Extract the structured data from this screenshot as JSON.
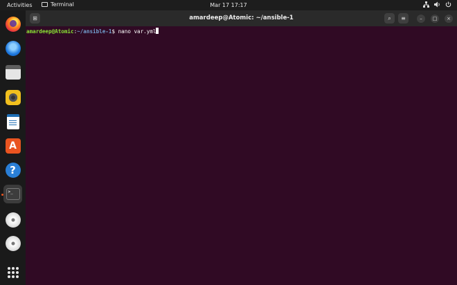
{
  "topbar": {
    "activities_label": "Activities",
    "app_label": "Terminal",
    "clock": "Mar 17  17:17",
    "tray_icons": [
      "network-icon",
      "volume-icon",
      "power-icon"
    ]
  },
  "dock": {
    "items": [
      {
        "name": "firefox",
        "icon": "firefox-icon"
      },
      {
        "name": "thunderbird",
        "icon": "thunderbird-icon"
      },
      {
        "name": "files",
        "icon": "files-icon"
      },
      {
        "name": "rhythmbox",
        "icon": "rhythmbox-icon"
      },
      {
        "name": "libreoffice-writer",
        "icon": "writer-icon"
      },
      {
        "name": "ubuntu-software",
        "icon": "software-icon"
      },
      {
        "name": "help",
        "icon": "help-icon"
      },
      {
        "name": "terminal",
        "icon": "terminal-icon",
        "active": true
      },
      {
        "name": "disc-1",
        "icon": "disc-icon"
      },
      {
        "name": "disc-2",
        "icon": "disc-icon"
      },
      {
        "name": "show-apps",
        "icon": "app-grid-icon"
      }
    ],
    "software_glyph": "A",
    "help_glyph": "?",
    "terminal_glyph": ">_"
  },
  "window": {
    "title": "amardeep@Atomic: ~/ansible-1",
    "new_tab_glyph": "⊞",
    "search_glyph": "⌕",
    "menu_glyph": "≡",
    "minimize_glyph": "–",
    "maximize_glyph": "□",
    "close_glyph": "×"
  },
  "terminal": {
    "user_host": "amardeep@Atomic",
    "sep": ":",
    "path": "~/ansible-1",
    "prompt_symbol": "$",
    "command": " nano var.yml"
  },
  "colors": {
    "terminal_bg": "#300a24",
    "prompt_user": "#8ae234",
    "prompt_path": "#729fcf",
    "accent": "#e95420"
  }
}
